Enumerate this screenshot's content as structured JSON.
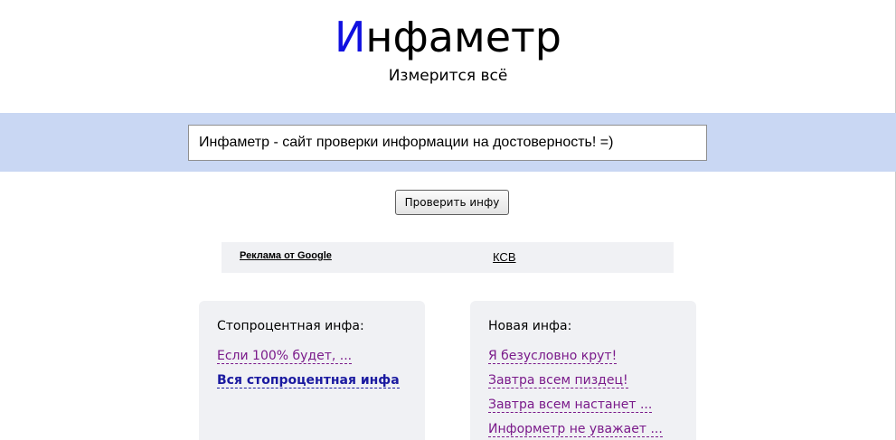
{
  "header": {
    "logo_first_letter": "И",
    "logo_rest": "нфаметр",
    "tagline": "Измерится всё"
  },
  "search": {
    "value": "Инфаметр - сайт проверки информации на достоверность! =)"
  },
  "check_button_label": "Проверить инфу",
  "ad_bar": {
    "label": "Реклама от Google",
    "link": "КСВ"
  },
  "left_panel": {
    "title": "Стопроцентная инфа:",
    "items": [
      "Если 100% будет, ..."
    ],
    "all_link": "Вся стопроцентная инфа"
  },
  "right_panel": {
    "title": "Новая инфа:",
    "items": [
      "Я безусловно крут!",
      "Завтра всем пиздец!",
      "Завтра всем настанет ...",
      "Информетр не уважает ..."
    ]
  },
  "colors": {
    "logo_accent": "#1010e0",
    "search_band": "#c9d7f3",
    "panel_bg": "#f0f1f4",
    "visited_link": "#7a1a8a",
    "strong_link": "#1a1aa0"
  }
}
